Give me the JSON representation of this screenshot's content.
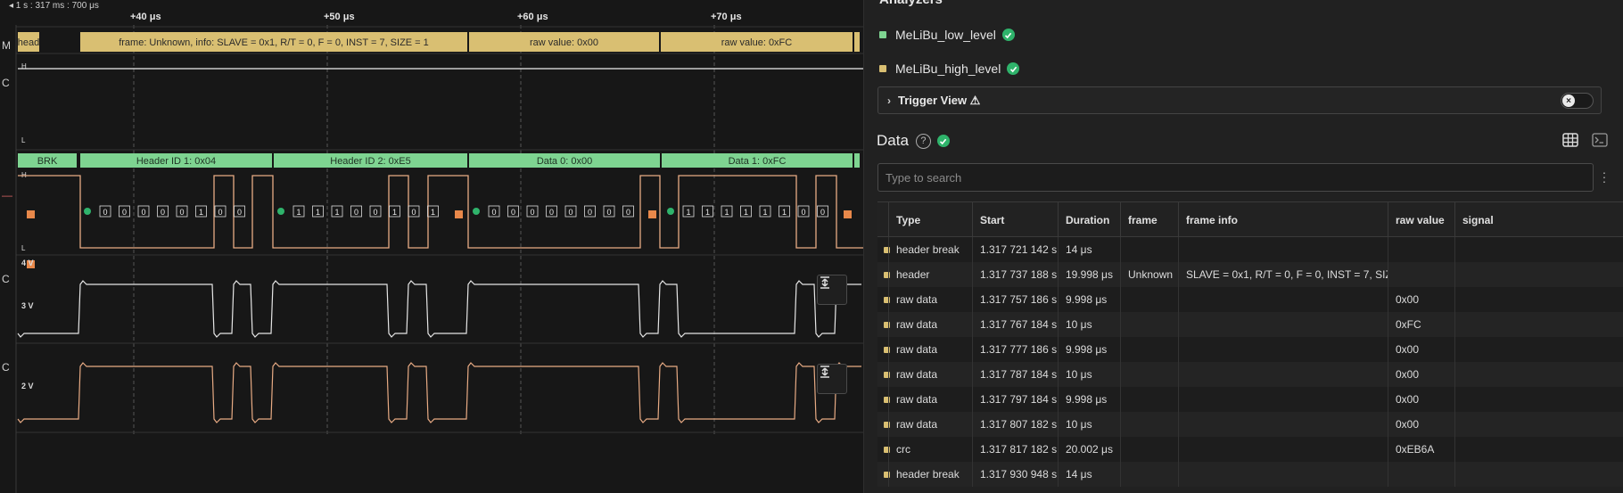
{
  "timeline": {
    "origin": "◂ 1 s : 317 ms : 700 μs",
    "ticks": [
      "+40 μs",
      "+50 μs",
      "+60 μs",
      "+70 μs"
    ]
  },
  "channel_letters": [
    "M",
    "C",
    "—",
    "C",
    "C"
  ],
  "high_level_frames": [
    {
      "label": "head"
    },
    {
      "label": "frame: Unknown, info: SLAVE = 0x1, R/T = 0, F = 0, INST = 7, SIZE = 1"
    },
    {
      "label": "raw value: 0x00"
    },
    {
      "label": "raw value: 0xFC"
    }
  ],
  "low_level_frames": [
    {
      "label": "BRK"
    },
    {
      "label": "Header ID 1: 0x04"
    },
    {
      "label": "Header ID 2: 0xE5"
    },
    {
      "label": "Data 0: 0x00"
    },
    {
      "label": "Data 1: 0xFC"
    }
  ],
  "digital_levels": {
    "high": "H",
    "low": "L"
  },
  "bit_groups": [
    [
      "0",
      "0",
      "0",
      "0",
      "0",
      "1",
      "0",
      "0"
    ],
    [
      "1",
      "1",
      "1",
      "0",
      "0",
      "1",
      "0",
      "1"
    ],
    [
      "0",
      "0",
      "0",
      "0",
      "0",
      "0",
      "0",
      "0"
    ],
    [
      "1",
      "1",
      "1",
      "1",
      "1",
      "1",
      "0",
      "0"
    ]
  ],
  "analog_labels": {
    "ch1_top": "4 V",
    "ch1_mid": "3 V",
    "ch2_mid": "2 V"
  },
  "colors": {
    "low_level": "#7ed491",
    "high_level": "#d9bf72",
    "digital_trace": "#e8ab84",
    "analog_white": "#e6e6e6",
    "analog_orange": "#e8ab84",
    "dot_green": "#2fb36b",
    "marker_orange": "#e8884a",
    "check_green": "#2fb36b"
  },
  "analyzers": {
    "title_partial": "Analyzers",
    "items": [
      {
        "name": "MeLiBu_low_level",
        "color": "#7ed491"
      },
      {
        "name": "MeLiBu_high_level",
        "color": "#d9bf72"
      }
    ]
  },
  "trigger_view": {
    "label": "Trigger View ⚠",
    "toggle_icon": "close-icon"
  },
  "data_panel": {
    "title": "Data",
    "help": "?",
    "search_placeholder": "Type to search",
    "columns": [
      "Type",
      "Start",
      "Duration",
      "frame",
      "frame info",
      "raw value",
      "signal"
    ],
    "rows": [
      {
        "type": "header break",
        "start": "1.317 721 142 s",
        "duration": "14 μs",
        "frame": "",
        "frame_info": "",
        "raw_value": "",
        "signal": ""
      },
      {
        "type": "header",
        "start": "1.317 737 188 s",
        "duration": "19.998 μs",
        "frame": "Unknown",
        "frame_info": "SLAVE = 0x1, R/T = 0, F = 0, INST = 7, SIZE = 1",
        "raw_value": "",
        "signal": ""
      },
      {
        "type": "raw data",
        "start": "1.317 757 186 s",
        "duration": "9.998 μs",
        "frame": "",
        "frame_info": "",
        "raw_value": "0x00",
        "signal": ""
      },
      {
        "type": "raw data",
        "start": "1.317 767 184 s",
        "duration": "10 μs",
        "frame": "",
        "frame_info": "",
        "raw_value": "0xFC",
        "signal": ""
      },
      {
        "type": "raw data",
        "start": "1.317 777 186 s",
        "duration": "9.998 μs",
        "frame": "",
        "frame_info": "",
        "raw_value": "0x00",
        "signal": ""
      },
      {
        "type": "raw data",
        "start": "1.317 787 184 s",
        "duration": "10 μs",
        "frame": "",
        "frame_info": "",
        "raw_value": "0x00",
        "signal": ""
      },
      {
        "type": "raw data",
        "start": "1.317 797 184 s",
        "duration": "9.998 μs",
        "frame": "",
        "frame_info": "",
        "raw_value": "0x00",
        "signal": ""
      },
      {
        "type": "raw data",
        "start": "1.317 807 182 s",
        "duration": "10 μs",
        "frame": "",
        "frame_info": "",
        "raw_value": "0x00",
        "signal": ""
      },
      {
        "type": "crc",
        "start": "1.317 817 182 s",
        "duration": "20.002 μs",
        "frame": "",
        "frame_info": "",
        "raw_value": "0xEB6A",
        "signal": ""
      },
      {
        "type": "header break",
        "start": "1.317 930 948 s",
        "duration": "14 μs",
        "frame": "",
        "frame_info": "",
        "raw_value": "",
        "signal": ""
      }
    ]
  }
}
